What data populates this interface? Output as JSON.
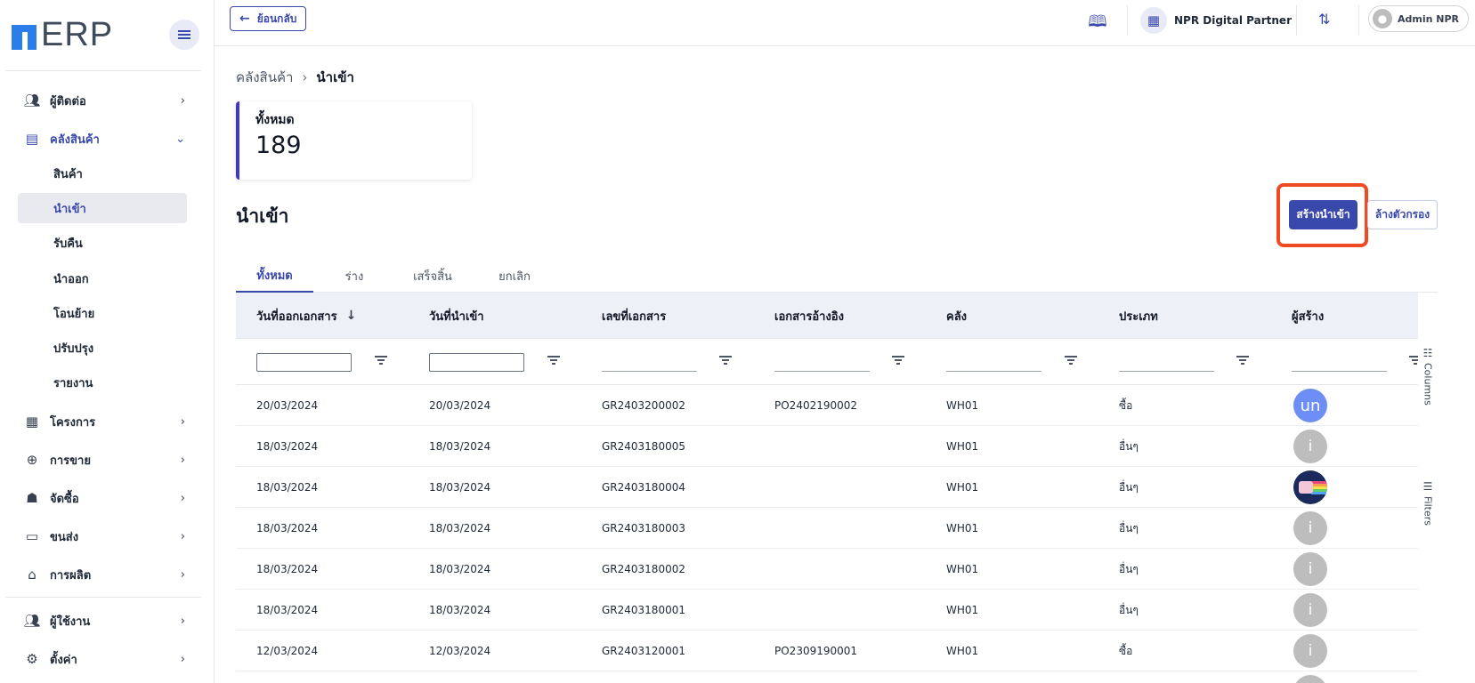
{
  "app": {
    "logo_text": "ERP"
  },
  "sidebar": {
    "items": [
      {
        "label": "ผู้ติดต่อ",
        "icon": "contacts-icon"
      },
      {
        "label": "คลังสินค้า",
        "icon": "archive-icon",
        "open": true,
        "sub_items": [
          "สินค้า",
          "นำเข้า",
          "รับคืน",
          "นำออก",
          "โอนย้าย",
          "ปรับปรุง",
          "รายงาน"
        ],
        "active_sub": "นำเข้า"
      },
      {
        "label": "โครงการ",
        "icon": "project-icon"
      },
      {
        "label": "การขาย",
        "icon": "plus-circle-icon"
      },
      {
        "label": "จัดซื้อ",
        "icon": "cart-icon"
      },
      {
        "label": "ขนส่ง",
        "icon": "truck-icon"
      },
      {
        "label": "การผลิต",
        "icon": "factory-icon"
      }
    ],
    "bottom_items": [
      {
        "label": "ผู้ใช้งาน",
        "icon": "users-icon"
      },
      {
        "label": "ตั้งค่า",
        "icon": "gear-icon"
      }
    ]
  },
  "topbar": {
    "back_label": "ย้อนกลับ",
    "company_name": "NPR Digital Partner",
    "user_name": "Admin NPR"
  },
  "breadcrumb": {
    "parent": "คลังสินค้า",
    "current": "นำเข้า"
  },
  "stat": {
    "label": "ทั้งหมด",
    "value": "189"
  },
  "page_title": "นำเข้า",
  "actions": {
    "create_label": "สร้างนำเข้า",
    "clear_label": "ล้างตัวกรอง"
  },
  "tabs": [
    "ทั้งหมด",
    "ร่าง",
    "เสร็จสิ้น",
    "ยกเลิก"
  ],
  "table": {
    "columns": [
      "วันที่ออกเอกสาร",
      "วันที่นำเข้า",
      "เลขที่เอกสาร",
      "เอกสารอ้างอิง",
      "คลัง",
      "ประเภท",
      "ผู้สร้าง"
    ],
    "rows": [
      {
        "issue_date": "20/03/2024",
        "import_date": "20/03/2024",
        "doc_no": "GR2403200002",
        "ref": "PO2402190002",
        "warehouse": "WH01",
        "type": "ซื้อ",
        "creator": "un"
      },
      {
        "issue_date": "18/03/2024",
        "import_date": "18/03/2024",
        "doc_no": "GR2403180005",
        "ref": "",
        "warehouse": "WH01",
        "type": "อื่นๆ",
        "creator": "i"
      },
      {
        "issue_date": "18/03/2024",
        "import_date": "18/03/2024",
        "doc_no": "GR2403180004",
        "ref": "",
        "warehouse": "WH01",
        "type": "อื่นๆ",
        "creator": ""
      },
      {
        "issue_date": "18/03/2024",
        "import_date": "18/03/2024",
        "doc_no": "GR2403180003",
        "ref": "",
        "warehouse": "WH01",
        "type": "อื่นๆ",
        "creator": "i"
      },
      {
        "issue_date": "18/03/2024",
        "import_date": "18/03/2024",
        "doc_no": "GR2403180002",
        "ref": "",
        "warehouse": "WH01",
        "type": "อื่นๆ",
        "creator": "i"
      },
      {
        "issue_date": "18/03/2024",
        "import_date": "18/03/2024",
        "doc_no": "GR2403180001",
        "ref": "",
        "warehouse": "WH01",
        "type": "อื่นๆ",
        "creator": "i"
      },
      {
        "issue_date": "12/03/2024",
        "import_date": "12/03/2024",
        "doc_no": "GR2403120001",
        "ref": "PO2309190001",
        "warehouse": "WH01",
        "type": "ซื้อ",
        "creator": "i"
      }
    ]
  },
  "side_tools": {
    "columns_label": "Columns",
    "filters_label": "Filters"
  },
  "colors": {
    "primary": "#3949ab",
    "highlight": "#f04a23",
    "header_bg": "#eef0f8"
  }
}
